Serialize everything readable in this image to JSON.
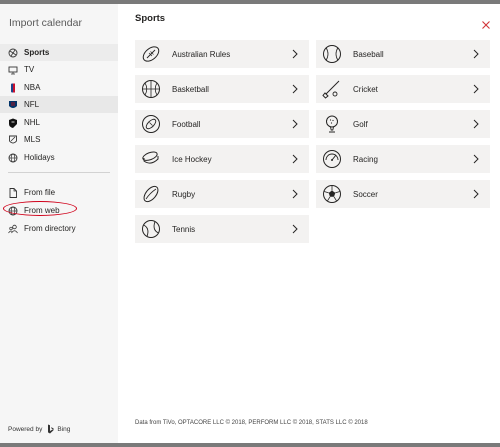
{
  "sidebar": {
    "title": "Import calendar",
    "items": [
      {
        "label": "Sports",
        "icon": "sports-icon"
      },
      {
        "label": "TV",
        "icon": "tv-icon"
      },
      {
        "label": "NBA",
        "icon": "nba-icon"
      },
      {
        "label": "NFL",
        "icon": "nfl-icon"
      },
      {
        "label": "NHL",
        "icon": "nhl-icon"
      },
      {
        "label": "MLS",
        "icon": "mls-icon"
      },
      {
        "label": "Holidays",
        "icon": "globe-icon"
      },
      {
        "label": "From file",
        "icon": "file-icon"
      },
      {
        "label": "From web",
        "icon": "globe-icon"
      },
      {
        "label": "From directory",
        "icon": "people-icon"
      }
    ],
    "selected": "Sports",
    "powered_by": "Powered by",
    "bing": "Bing"
  },
  "main": {
    "heading": "Sports",
    "sports": [
      {
        "label": "Australian Rules",
        "icon": "australian-rules-ball-icon"
      },
      {
        "label": "Baseball",
        "icon": "baseball-icon"
      },
      {
        "label": "Basketball",
        "icon": "basketball-icon"
      },
      {
        "label": "Cricket",
        "icon": "cricket-icon"
      },
      {
        "label": "Football",
        "icon": "football-icon"
      },
      {
        "label": "Golf",
        "icon": "golf-icon"
      },
      {
        "label": "Ice Hockey",
        "icon": "hockey-puck-icon"
      },
      {
        "label": "Racing",
        "icon": "racing-icon"
      },
      {
        "label": "Rugby",
        "icon": "rugby-ball-icon"
      },
      {
        "label": "Soccer",
        "icon": "soccer-ball-icon"
      },
      {
        "label": "Tennis",
        "icon": "tennis-ball-icon"
      }
    ],
    "footer": "Data from TiVo, OPTACORE LLC © 2018, PERFORM LLC © 2018, STATS LLC © 2018"
  },
  "colors": {
    "sidebar_bg": "#f6f6f6",
    "tile_bg": "#f3f2f1",
    "close_red": "#d13438",
    "annotation_red": "#d0021b"
  }
}
